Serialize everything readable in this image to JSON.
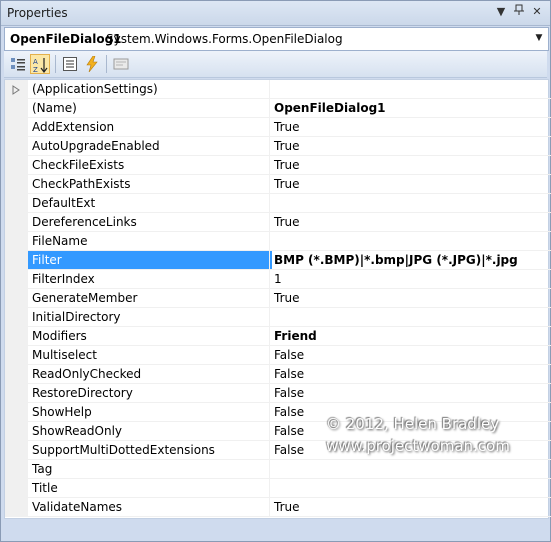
{
  "panel": {
    "title": "Properties"
  },
  "object": {
    "name": "OpenFileDialog1",
    "type": "System.Windows.Forms.OpenFileDialog"
  },
  "toolbar": {
    "buttons": [
      {
        "name": "categorized-button",
        "icon": "categorized-icon"
      },
      {
        "name": "alphabetical-button",
        "icon": "alphabetical-icon",
        "active": true
      },
      {
        "name": "properties-button",
        "icon": "properties-icon"
      },
      {
        "name": "events-button",
        "icon": "lightning-icon"
      },
      {
        "name": "property-pages-button",
        "icon": "property-pages-icon"
      }
    ]
  },
  "properties": [
    {
      "name": "(ApplicationSettings)",
      "value": ""
    },
    {
      "name": "(Name)",
      "value": "OpenFileDialog1"
    },
    {
      "name": "AddExtension",
      "value": "True"
    },
    {
      "name": "AutoUpgradeEnabled",
      "value": "True"
    },
    {
      "name": "CheckFileExists",
      "value": "True"
    },
    {
      "name": "CheckPathExists",
      "value": "True"
    },
    {
      "name": "DefaultExt",
      "value": ""
    },
    {
      "name": "DereferenceLinks",
      "value": "True"
    },
    {
      "name": "FileName",
      "value": ""
    },
    {
      "name": "Filter",
      "value": "BMP (*.BMP)|*.bmp|JPG (*.JPG)|*.jpg"
    },
    {
      "name": "FilterIndex",
      "value": "1"
    },
    {
      "name": "GenerateMember",
      "value": "True"
    },
    {
      "name": "InitialDirectory",
      "value": ""
    },
    {
      "name": "Modifiers",
      "value": "Friend"
    },
    {
      "name": "Multiselect",
      "value": "False"
    },
    {
      "name": "ReadOnlyChecked",
      "value": "False"
    },
    {
      "name": "RestoreDirectory",
      "value": "False"
    },
    {
      "name": "ShowHelp",
      "value": "False"
    },
    {
      "name": "ShowReadOnly",
      "value": "False"
    },
    {
      "name": "SupportMultiDottedExtensions",
      "value": "False"
    },
    {
      "name": "Tag",
      "value": ""
    },
    {
      "name": "Title",
      "value": ""
    },
    {
      "name": "ValidateNames",
      "value": "True"
    }
  ],
  "watermark": {
    "line1": "© 2012, Helen Bradley",
    "line2": "www.projectwoman.com"
  },
  "colors": {
    "selection": "#3399ff",
    "chrome": "#cfdbee"
  }
}
